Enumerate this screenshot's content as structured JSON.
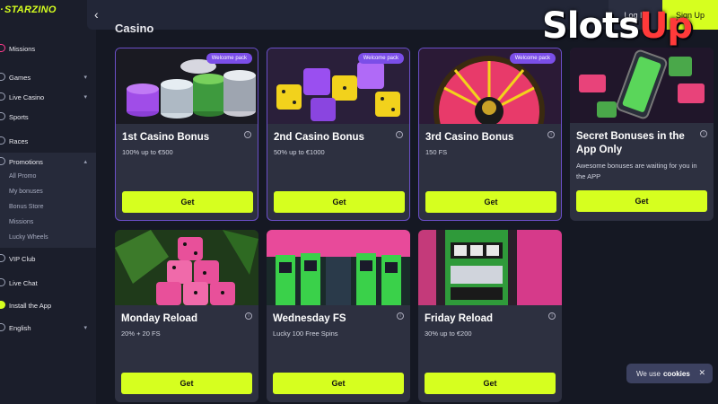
{
  "brand": {
    "logo": "STARZINO",
    "accent": "#d6ff1f"
  },
  "sidebar": {
    "items": [
      {
        "label": "Missions",
        "icon": "missions-icon"
      },
      {
        "label": "Games",
        "icon": "games-icon",
        "chevron": "▾"
      },
      {
        "label": "Live Casino",
        "icon": "live-casino-icon",
        "chevron": "▾"
      },
      {
        "label": "Sports",
        "icon": "sports-icon"
      },
      {
        "label": "Races",
        "icon": "races-icon"
      },
      {
        "label": "Promotions",
        "icon": "promotions-icon",
        "chevron": "▴"
      },
      {
        "label": "VIP Club",
        "icon": "vip-icon"
      },
      {
        "label": "Live Chat",
        "icon": "chat-icon"
      },
      {
        "label": "Install the App",
        "icon": "install-icon"
      },
      {
        "label": "English",
        "icon": "globe-icon",
        "chevron": "▾"
      }
    ],
    "promotions_sub": [
      "All Promo",
      "My bonuses",
      "Bonus Store",
      "Missions",
      "Lucky Wheels"
    ]
  },
  "topbar": {
    "back": "‹",
    "login": "Log In",
    "signup": "Sign Up"
  },
  "section": {
    "title": "Casino"
  },
  "cards": [
    {
      "title": "1st Casino Bonus",
      "desc": "100% up to €500",
      "button": "Get",
      "badge": "Welcome pack"
    },
    {
      "title": "2nd Casino Bonus",
      "desc": "50% up to €1000",
      "button": "Get",
      "badge": "Welcome pack"
    },
    {
      "title": "3rd Casino Bonus",
      "desc": "150 FS",
      "button": "Get",
      "badge": "Welcome pack"
    },
    {
      "title": "Secret Bonuses in the App Only",
      "desc": "Awesome bonuses are waiting for you in the APP",
      "button": "Get"
    },
    {
      "title": "Monday Reload",
      "desc": "20% + 20 FS",
      "button": "Get"
    },
    {
      "title": "Wednesday FS",
      "desc": "Lucky 100 Free Spins",
      "button": "Get"
    },
    {
      "title": "Friday Reload",
      "desc": "30% up to €200",
      "button": "Get"
    }
  ],
  "info_glyph": "i",
  "cookies": {
    "text": "We use",
    "bold": "cookies",
    "close": "✕"
  },
  "watermark": {
    "part1": "Slots",
    "part2": "Up"
  }
}
